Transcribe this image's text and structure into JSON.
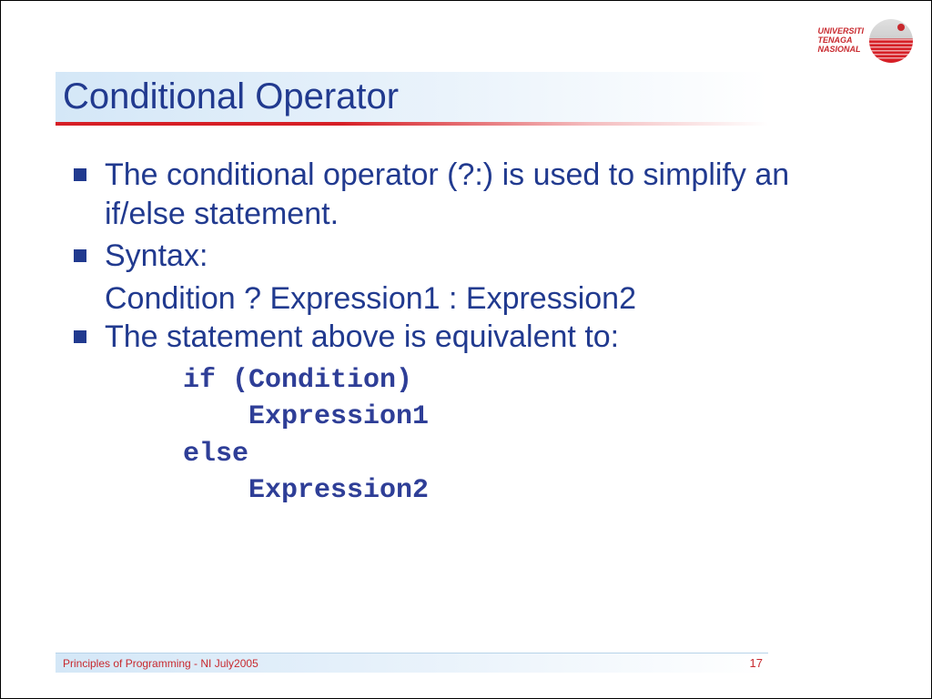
{
  "logo": {
    "line1": "UNIVERSITI",
    "line2": "TENAGA",
    "line3": "NASIONAL"
  },
  "title": "Conditional Operator",
  "bullets": {
    "b1": "The conditional operator (?:) is used to simplify an if/else statement.",
    "b2": "Syntax:",
    "b2_sub": "Condition ? Expression1 : Expression2",
    "b3": "The statement above is equivalent to:"
  },
  "code": {
    "l1": "if (Condition)",
    "l2": "    Expression1",
    "l3": "else",
    "l4": "    Expression2"
  },
  "footer": {
    "left": "Principles of Programming - NI July2005",
    "page": "17"
  }
}
